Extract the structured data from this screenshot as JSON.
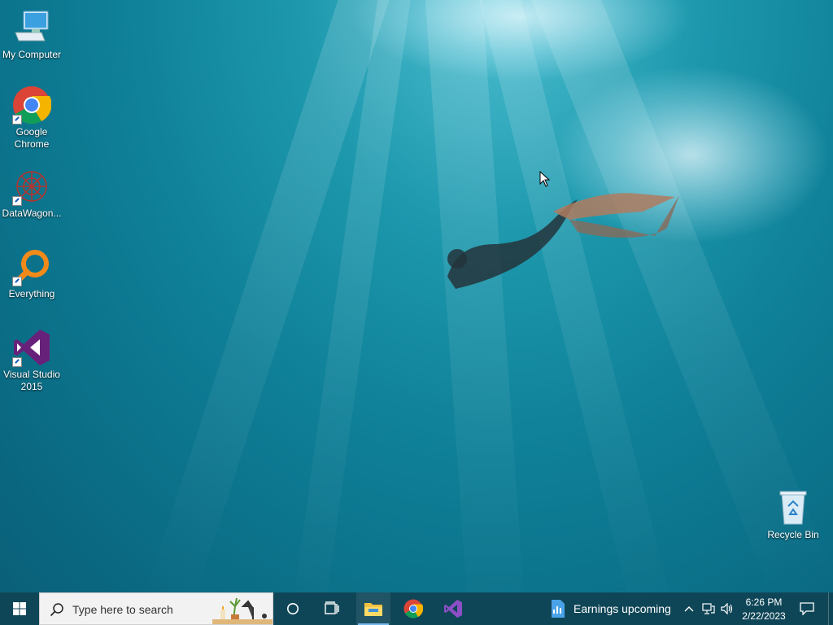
{
  "desktop": {
    "icons": [
      {
        "label": "My Computer"
      },
      {
        "label": "Google Chrome"
      },
      {
        "label": "DataWagon..."
      },
      {
        "label": "Everything"
      },
      {
        "label": "Visual Studio 2015"
      },
      {
        "label": "Recycle Bin"
      }
    ]
  },
  "taskbar": {
    "search_placeholder": "Type here to search",
    "news_widget": "Earnings upcoming",
    "clock_time": "6:26 PM",
    "clock_date": "2/22/2023",
    "pinned": [
      "file-explorer-icon",
      "chrome-icon",
      "visual-studio-icon"
    ]
  },
  "colors": {
    "taskbar_bg": "#0f4657",
    "search_bg": "#f2f2f2",
    "active_indicator": "#76b9ed",
    "vs_purple": "#68217a"
  }
}
